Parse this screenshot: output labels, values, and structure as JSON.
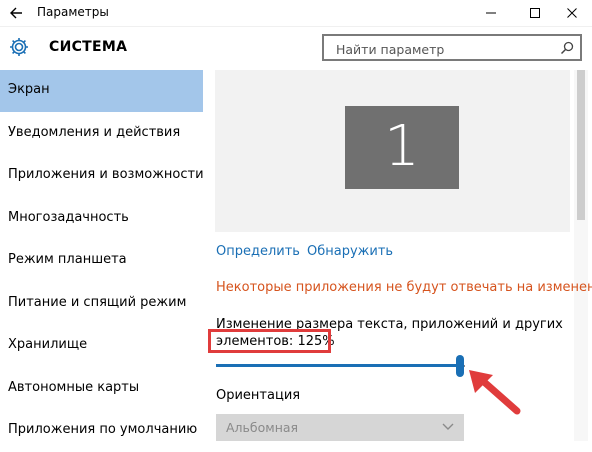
{
  "window": {
    "title": "Параметры"
  },
  "header": {
    "title": "СИСТЕМА",
    "search_placeholder": "Найти параметр"
  },
  "sidebar": {
    "items": [
      {
        "label": "Экран",
        "active": true
      },
      {
        "label": "Уведомления и действия",
        "active": false
      },
      {
        "label": "Приложения и возможности",
        "active": false
      },
      {
        "label": "Многозадачность",
        "active": false
      },
      {
        "label": "Режим планшета",
        "active": false
      },
      {
        "label": "Питание и спящий режим",
        "active": false
      },
      {
        "label": "Хранилище",
        "active": false
      },
      {
        "label": "Автономные карты",
        "active": false
      },
      {
        "label": "Приложения по умолчанию",
        "active": false
      }
    ]
  },
  "display": {
    "monitor_number": "1",
    "identify_label": "Определить",
    "detect_label": "Обнаружить",
    "warning_text": "Некоторые приложения не будут отвечать на изменения м",
    "scale_label": "Изменение размера текста, приложений и других",
    "scale_value_text": "элементов: 125%",
    "scale_percent": 125,
    "orientation_label": "Ориентация",
    "orientation_value": "Альбомная"
  },
  "colors": {
    "accent": "#1a6fb5",
    "active_nav": "#a3c6ea",
    "warning": "#d6541e",
    "annotation": "#e03c3c"
  }
}
